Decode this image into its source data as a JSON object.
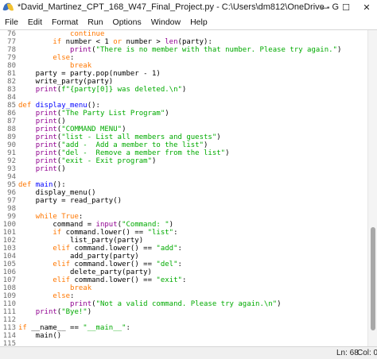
{
  "window": {
    "title": "*David_Martinez_CPT_168_W47_Final_Project.py - C:\\Users\\dm812\\OneDrive - Greenville Technic...",
    "controls": {
      "minimize": "—",
      "maximize": "☐",
      "close": "✕"
    }
  },
  "menu": [
    "File",
    "Edit",
    "Format",
    "Run",
    "Options",
    "Window",
    "Help"
  ],
  "colors": {
    "keyword": "#ff7700",
    "builtin": "#900090",
    "string": "#00aa00",
    "definition": "#0000ff",
    "default": "#000000"
  },
  "editor": {
    "line_numbers": [
      "76",
      "77",
      "78",
      "79",
      "80",
      "81",
      "82",
      "83",
      "84",
      "85",
      "86",
      "87",
      "88",
      "89",
      "90",
      "91",
      "92",
      "93",
      "94",
      "95",
      "96",
      "97",
      "98",
      "99",
      "100",
      "101",
      "102",
      "103",
      "104",
      "105",
      "106",
      "107",
      "108",
      "109",
      "110",
      "111",
      "112",
      "113",
      "114",
      "115"
    ],
    "lines": [
      [
        [
          "            ",
          "n"
        ],
        [
          "continue",
          "k"
        ]
      ],
      [
        [
          "        ",
          "n"
        ],
        [
          "if",
          "k"
        ],
        [
          " number < 1 ",
          "n"
        ],
        [
          "or",
          "k"
        ],
        [
          " number > ",
          "n"
        ],
        [
          "len",
          "b"
        ],
        [
          "(party):",
          "n"
        ]
      ],
      [
        [
          "            ",
          "n"
        ],
        [
          "print",
          "b"
        ],
        [
          "(",
          "n"
        ],
        [
          "\"There is no member with that number. Please try again.\"",
          "s"
        ],
        [
          ")",
          "n"
        ]
      ],
      [
        [
          "        ",
          "n"
        ],
        [
          "else",
          "k"
        ],
        [
          ":",
          "n"
        ]
      ],
      [
        [
          "            ",
          "n"
        ],
        [
          "break",
          "k"
        ]
      ],
      [
        [
          "    party = party.pop(number - 1)",
          "n"
        ]
      ],
      [
        [
          "    write_party(party)",
          "n"
        ]
      ],
      [
        [
          "    ",
          "n"
        ],
        [
          "print",
          "b"
        ],
        [
          "(",
          "n"
        ],
        [
          "f\"{party[0]} was deleted.\\n\"",
          "s"
        ],
        [
          ")",
          "n"
        ]
      ],
      [
        [
          "",
          "n"
        ]
      ],
      [
        [
          "def",
          "k"
        ],
        [
          " ",
          "n"
        ],
        [
          "display_menu",
          "d"
        ],
        [
          "():",
          "n"
        ]
      ],
      [
        [
          "    ",
          "n"
        ],
        [
          "print",
          "b"
        ],
        [
          "(",
          "n"
        ],
        [
          "\"The Party List Program\"",
          "s"
        ],
        [
          ")",
          "n"
        ]
      ],
      [
        [
          "    ",
          "n"
        ],
        [
          "print",
          "b"
        ],
        [
          "()",
          "n"
        ]
      ],
      [
        [
          "    ",
          "n"
        ],
        [
          "print",
          "b"
        ],
        [
          "(",
          "n"
        ],
        [
          "\"COMMAND MENU\"",
          "s"
        ],
        [
          ")",
          "n"
        ]
      ],
      [
        [
          "    ",
          "n"
        ],
        [
          "print",
          "b"
        ],
        [
          "(",
          "n"
        ],
        [
          "\"list - List all members and guests\"",
          "s"
        ],
        [
          ")",
          "n"
        ]
      ],
      [
        [
          "    ",
          "n"
        ],
        [
          "print",
          "b"
        ],
        [
          "(",
          "n"
        ],
        [
          "\"add -  Add a member to the list\"",
          "s"
        ],
        [
          ")",
          "n"
        ]
      ],
      [
        [
          "    ",
          "n"
        ],
        [
          "print",
          "b"
        ],
        [
          "(",
          "n"
        ],
        [
          "\"del -  Remove a member from the list\"",
          "s"
        ],
        [
          ")",
          "n"
        ]
      ],
      [
        [
          "    ",
          "n"
        ],
        [
          "print",
          "b"
        ],
        [
          "(",
          "n"
        ],
        [
          "\"exit - Exit program\"",
          "s"
        ],
        [
          ")",
          "n"
        ]
      ],
      [
        [
          "    ",
          "n"
        ],
        [
          "print",
          "b"
        ],
        [
          "()",
          "n"
        ]
      ],
      [
        [
          "",
          "n"
        ]
      ],
      [
        [
          "def",
          "k"
        ],
        [
          " ",
          "n"
        ],
        [
          "main",
          "d"
        ],
        [
          "():",
          "n"
        ]
      ],
      [
        [
          "    display_menu()",
          "n"
        ]
      ],
      [
        [
          "    party = read_party()",
          "n"
        ]
      ],
      [
        [
          "",
          "n"
        ]
      ],
      [
        [
          "    ",
          "n"
        ],
        [
          "while",
          "k"
        ],
        [
          " ",
          "n"
        ],
        [
          "True",
          "k"
        ],
        [
          ":",
          "n"
        ]
      ],
      [
        [
          "        command = ",
          "n"
        ],
        [
          "input",
          "b"
        ],
        [
          "(",
          "n"
        ],
        [
          "\"Command: \"",
          "s"
        ],
        [
          ")",
          "n"
        ]
      ],
      [
        [
          "        ",
          "n"
        ],
        [
          "if",
          "k"
        ],
        [
          " command.lower() == ",
          "n"
        ],
        [
          "\"list\"",
          "s"
        ],
        [
          ":",
          "n"
        ]
      ],
      [
        [
          "            list_party(party)",
          "n"
        ]
      ],
      [
        [
          "        ",
          "n"
        ],
        [
          "elif",
          "k"
        ],
        [
          " command.lower() == ",
          "n"
        ],
        [
          "\"add\"",
          "s"
        ],
        [
          ":",
          "n"
        ]
      ],
      [
        [
          "            add_party(party)",
          "n"
        ]
      ],
      [
        [
          "        ",
          "n"
        ],
        [
          "elif",
          "k"
        ],
        [
          " command.lower() == ",
          "n"
        ],
        [
          "\"del\"",
          "s"
        ],
        [
          ":",
          "n"
        ]
      ],
      [
        [
          "            delete_party(party)",
          "n"
        ]
      ],
      [
        [
          "        ",
          "n"
        ],
        [
          "elif",
          "k"
        ],
        [
          " command.lower() == ",
          "n"
        ],
        [
          "\"exit\"",
          "s"
        ],
        [
          ":",
          "n"
        ]
      ],
      [
        [
          "            ",
          "n"
        ],
        [
          "break",
          "k"
        ]
      ],
      [
        [
          "        ",
          "n"
        ],
        [
          "else",
          "k"
        ],
        [
          ":",
          "n"
        ]
      ],
      [
        [
          "            ",
          "n"
        ],
        [
          "print",
          "b"
        ],
        [
          "(",
          "n"
        ],
        [
          "\"Not a valid command. Please try again.\\n\"",
          "s"
        ],
        [
          ")",
          "n"
        ]
      ],
      [
        [
          "    ",
          "n"
        ],
        [
          "print",
          "b"
        ],
        [
          "(",
          "n"
        ],
        [
          "\"Bye!\"",
          "s"
        ],
        [
          ")",
          "n"
        ]
      ],
      [
        [
          "",
          "n"
        ]
      ],
      [
        [
          "if",
          "k"
        ],
        [
          " __name__ == ",
          "n"
        ],
        [
          "\"__main__\"",
          "s"
        ],
        [
          ":",
          "n"
        ]
      ],
      [
        [
          "    main()",
          "n"
        ]
      ],
      [
        [
          "",
          "n"
        ]
      ]
    ]
  },
  "status": {
    "line": "Ln: 68",
    "col": "Col: 0"
  }
}
